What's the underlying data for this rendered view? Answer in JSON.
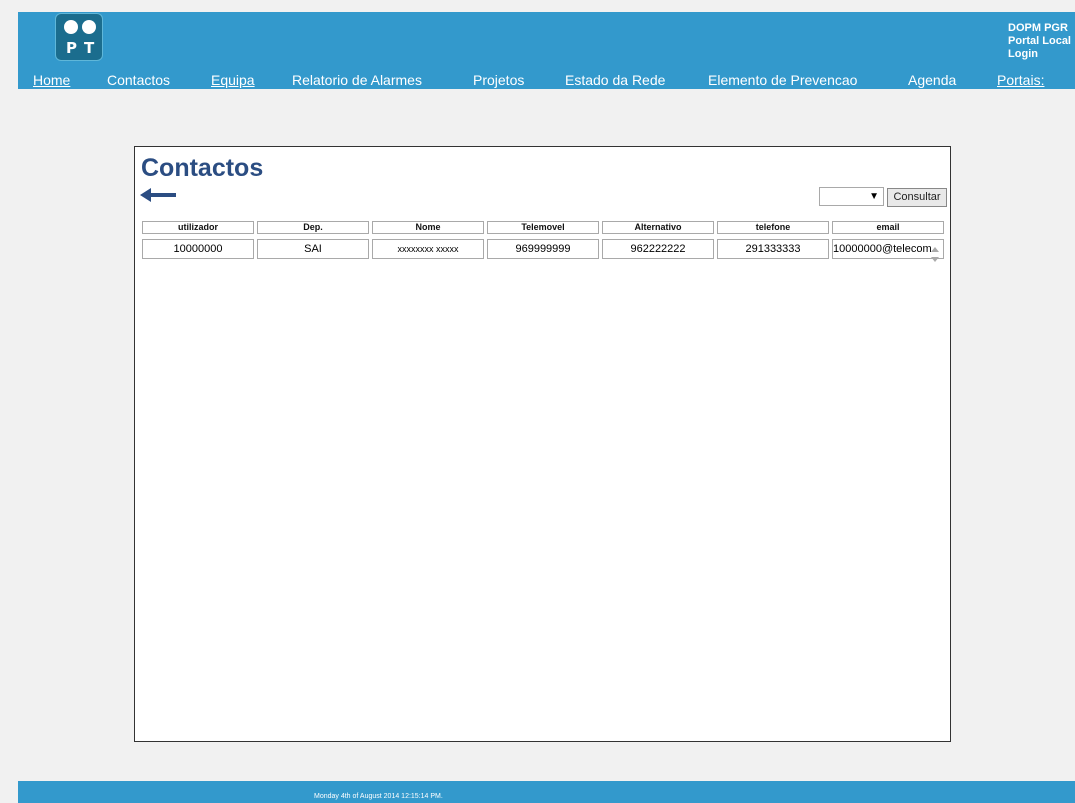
{
  "header": {
    "logo_letters": [
      "P",
      "T"
    ],
    "brand_line1": "DOPM PGR",
    "brand_line2": "Portal Local",
    "login": "Login",
    "background": "#3399cc"
  },
  "nav": {
    "items": [
      {
        "label": "Home"
      },
      {
        "label": "Contactos"
      },
      {
        "label": "Equipa"
      },
      {
        "label": "Relatorio de Alarmes"
      },
      {
        "label": "Projetos"
      },
      {
        "label": "Estado da Rede"
      },
      {
        "label": "Elemento de Prevencao"
      },
      {
        "label": "Agenda"
      },
      {
        "label": "Portais:"
      }
    ]
  },
  "page": {
    "title": "Contactos",
    "select_value": "",
    "consultar_label": "Consultar"
  },
  "table": {
    "columns": [
      "utilizador",
      "Dep.",
      "Nome",
      "Telemovel",
      "Alternativo",
      "telefone",
      "email"
    ],
    "rows": [
      [
        "10000000",
        "SAI",
        "xxxxxxxx xxxxx",
        "969999999",
        "962222222",
        "291333333",
        "10000000@telecom"
      ]
    ]
  },
  "footer": {
    "date": "Monday 4th of August 2014 12:15:14 PM."
  },
  "colors": {
    "accent": "#3399cc",
    "title": "#2b4d82"
  }
}
